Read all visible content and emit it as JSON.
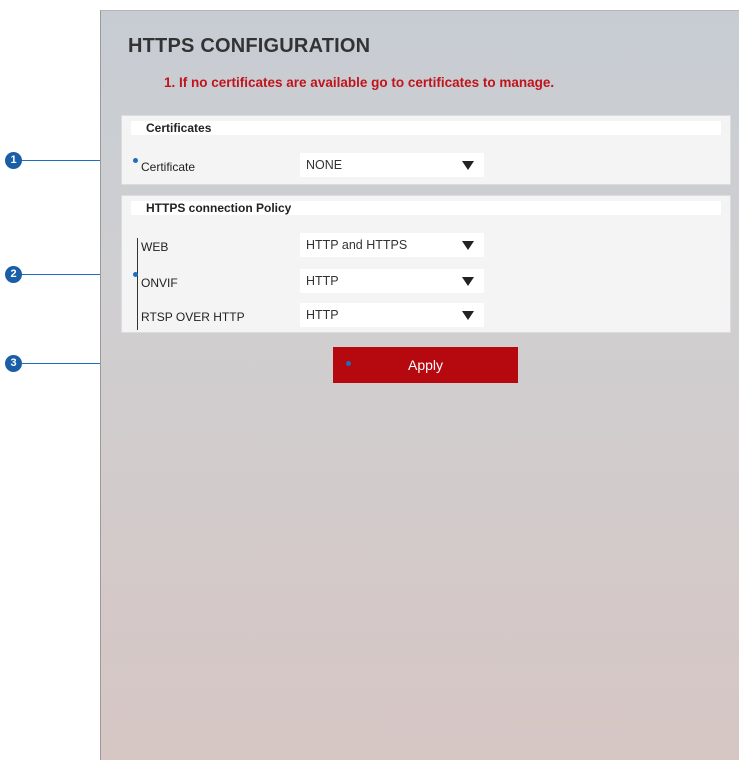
{
  "page": {
    "title": "HTTPS CONFIGURATION",
    "notice": "1.  If no certificates are available go to certificates to manage."
  },
  "certificates": {
    "header": "Certificates",
    "certificate_label": "Certificate",
    "certificate_value": "NONE"
  },
  "policy": {
    "header": "HTTPS connection Policy",
    "rows": [
      {
        "label": "WEB",
        "value": "HTTP and HTTPS"
      },
      {
        "label": "ONVIF",
        "value": "HTTP"
      },
      {
        "label": "RTSP OVER HTTP",
        "value": "HTTP"
      }
    ]
  },
  "apply_label": "Apply",
  "callouts": [
    "1",
    "2",
    "3"
  ],
  "colors": {
    "accent_red": "#b5090f",
    "notice_red": "#c0141c",
    "callout_blue": "#1a5ea8"
  }
}
